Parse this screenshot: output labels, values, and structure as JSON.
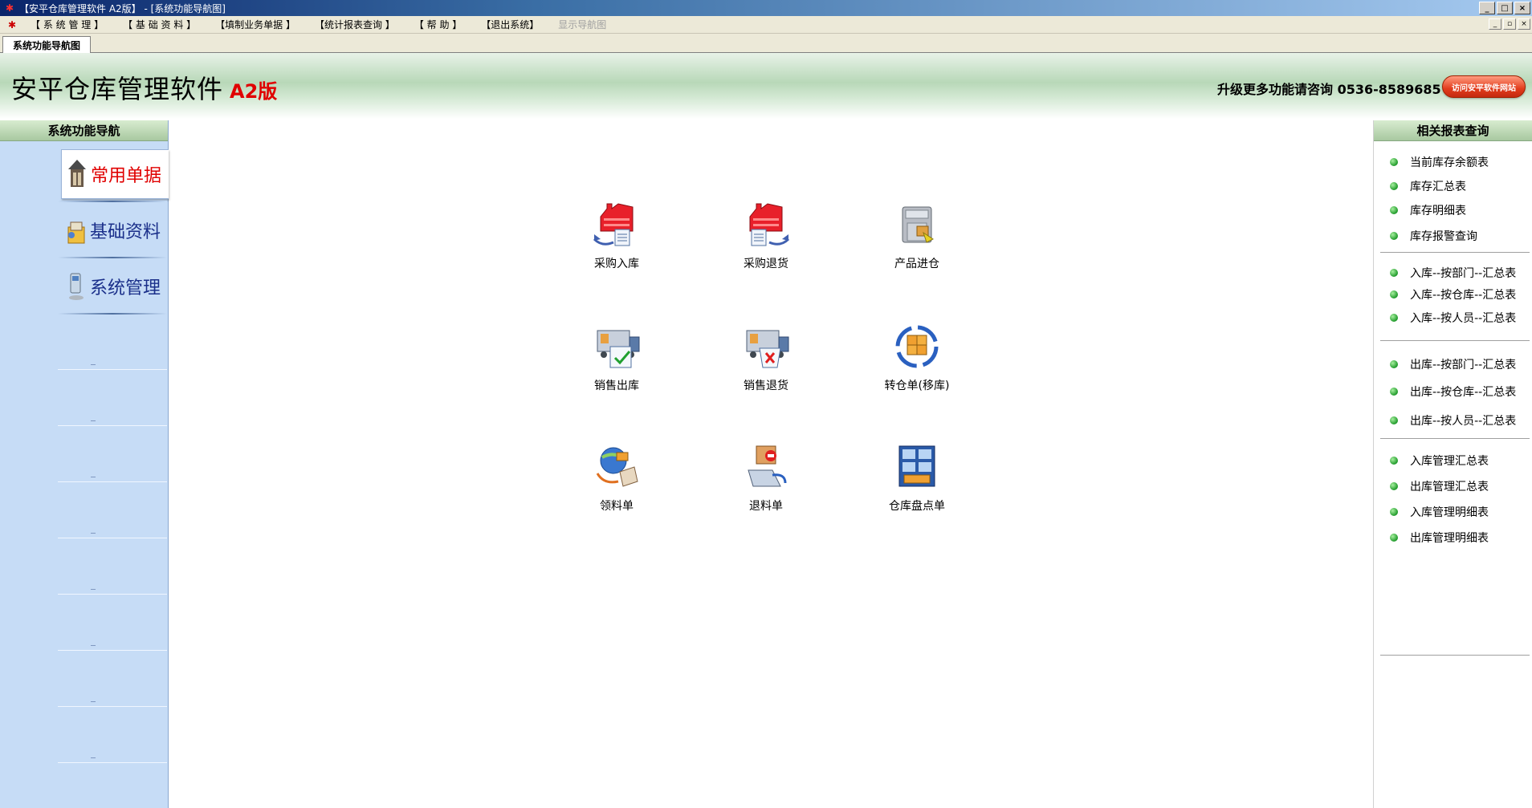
{
  "window": {
    "title": "【安平仓库管理软件 A2版】 - [系统功能导航图]",
    "controls": [
      "_",
      "□",
      "×"
    ]
  },
  "menubar": {
    "items": [
      {
        "label": "【 系 统 管 理 】",
        "enabled": true
      },
      {
        "label": "【 基 础 资 料 】",
        "enabled": true
      },
      {
        "label": "【填制业务单据 】",
        "enabled": true
      },
      {
        "label": "【统计报表查询 】",
        "enabled": true
      },
      {
        "label": "【 帮 助 】",
        "enabled": true
      },
      {
        "label": "【退出系统】",
        "enabled": true
      },
      {
        "label": "显示导航图",
        "enabled": false
      }
    ],
    "mdi_controls": [
      "_",
      "▫",
      "×"
    ]
  },
  "tabs": [
    {
      "label": "系统功能导航图",
      "active": true
    }
  ],
  "banner": {
    "app_name": "安平仓库管理软件",
    "version": "A2版",
    "hotline": "升级更多功能请咨询 0536-8589685",
    "visit_button": "访问安平软件网站"
  },
  "left_nav": {
    "header": "系统功能导航",
    "items": [
      {
        "label": "常用单据",
        "icon": "documents-icon",
        "active": true
      },
      {
        "label": "基础资料",
        "icon": "basic-data-icon",
        "active": false
      },
      {
        "label": "系统管理",
        "icon": "computer-icon",
        "active": false
      }
    ]
  },
  "functions": [
    {
      "label": "采购入库",
      "icon": "purchase-in-icon"
    },
    {
      "label": "采购退货",
      "icon": "purchase-return-icon"
    },
    {
      "label": "产品进仓",
      "icon": "product-in-icon"
    },
    {
      "label": "销售出库",
      "icon": "sales-out-icon"
    },
    {
      "label": "销售退货",
      "icon": "sales-return-icon"
    },
    {
      "label": "转仓单(移库)",
      "icon": "transfer-icon"
    },
    {
      "label": "领料单",
      "icon": "material-requisition-icon"
    },
    {
      "label": "退料单",
      "icon": "material-return-icon"
    },
    {
      "label": "仓库盘点单",
      "icon": "stocktake-icon"
    }
  ],
  "report_panel": {
    "header": "相关报表查询",
    "items": [
      "当前库存余额表",
      "库存汇总表",
      "库存明细表",
      "库存报警查询",
      "入库--按部门--汇总表",
      "入库--按仓库--汇总表",
      "入库--按人员--汇总表",
      "出库--按部门--汇总表",
      "出库--按仓库--汇总表",
      "出库--按人员--汇总表",
      "入库管理汇总表",
      "出库管理汇总表",
      "入库管理明细表",
      "出库管理明细表"
    ]
  }
}
